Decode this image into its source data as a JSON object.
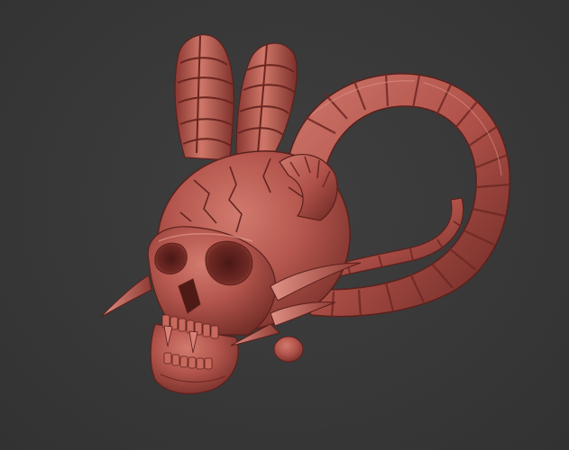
{
  "viewport": {
    "background_color": "#3a3a3a",
    "model": {
      "subject": "horned-demon-skull",
      "material_color": "#b5574e",
      "highlight_color": "#d98176",
      "shadow_color": "#5e211d"
    }
  }
}
